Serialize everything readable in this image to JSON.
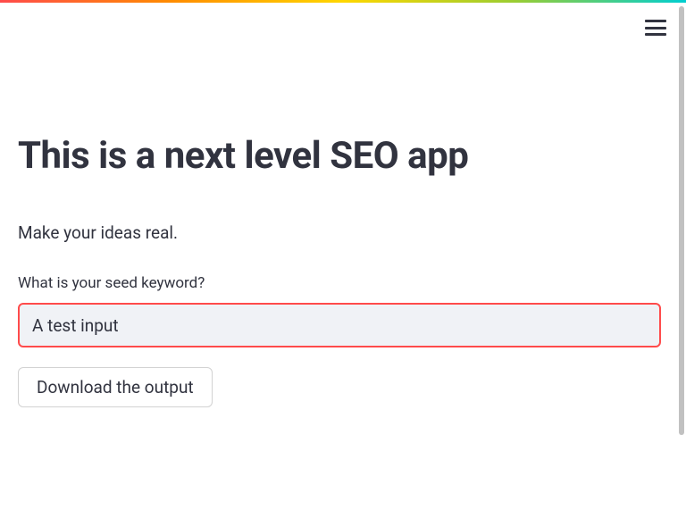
{
  "header": {
    "title": "This is a next level SEO app",
    "subtitle": "Make your ideas real."
  },
  "form": {
    "seed_keyword_label": "What is your seed keyword?",
    "seed_keyword_value": "A test input",
    "download_button_label": "Download the output"
  },
  "colors": {
    "accent": "#ff4b4b",
    "text": "#31333f",
    "input_bg": "#f0f2f6"
  }
}
